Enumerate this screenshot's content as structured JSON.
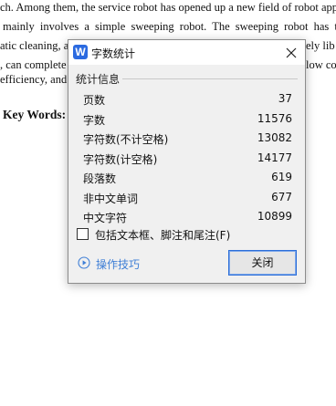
{
  "document": {
    "lines": [
      "ch. Among them, the service robot has opened up a new field of robot applic",
      "mainly involves a simple sweeping robot. The sweeping robot has the f",
      "atic cleaning, a",
      ", can complete",
      "efficiency, and h"
    ],
    "line_right_fragments": [
      "",
      "",
      "ely lib",
      "low co",
      ""
    ],
    "key_words_label": "Key Words:"
  },
  "dialog": {
    "app_icon_letter": "W",
    "title": "字数统计",
    "group_label": "统计信息",
    "stats": [
      {
        "label": "页数",
        "value": "37"
      },
      {
        "label": "字数",
        "value": "11576"
      },
      {
        "label": "字符数(不计空格)",
        "value": "13082"
      },
      {
        "label": "字符数(计空格)",
        "value": "14177"
      },
      {
        "label": "段落数",
        "value": "619"
      },
      {
        "label": "非中文单词",
        "value": "677"
      },
      {
        "label": "中文字符",
        "value": "10899"
      }
    ],
    "include_checkbox_label": "包括文本框、脚注和尾注(F)",
    "include_checkbox_checked": false,
    "tips_link_label": "操作技巧",
    "close_button_label": "关闭",
    "colors": {
      "accent": "#2c6ed8",
      "link": "#3f7fd6",
      "dialog_bg": "#f0f0f0",
      "app_icon_bg": "#2b6ae0"
    },
    "icons": {
      "app": "wps-writer-icon",
      "close": "close-icon",
      "tips": "play-circle-icon"
    }
  }
}
